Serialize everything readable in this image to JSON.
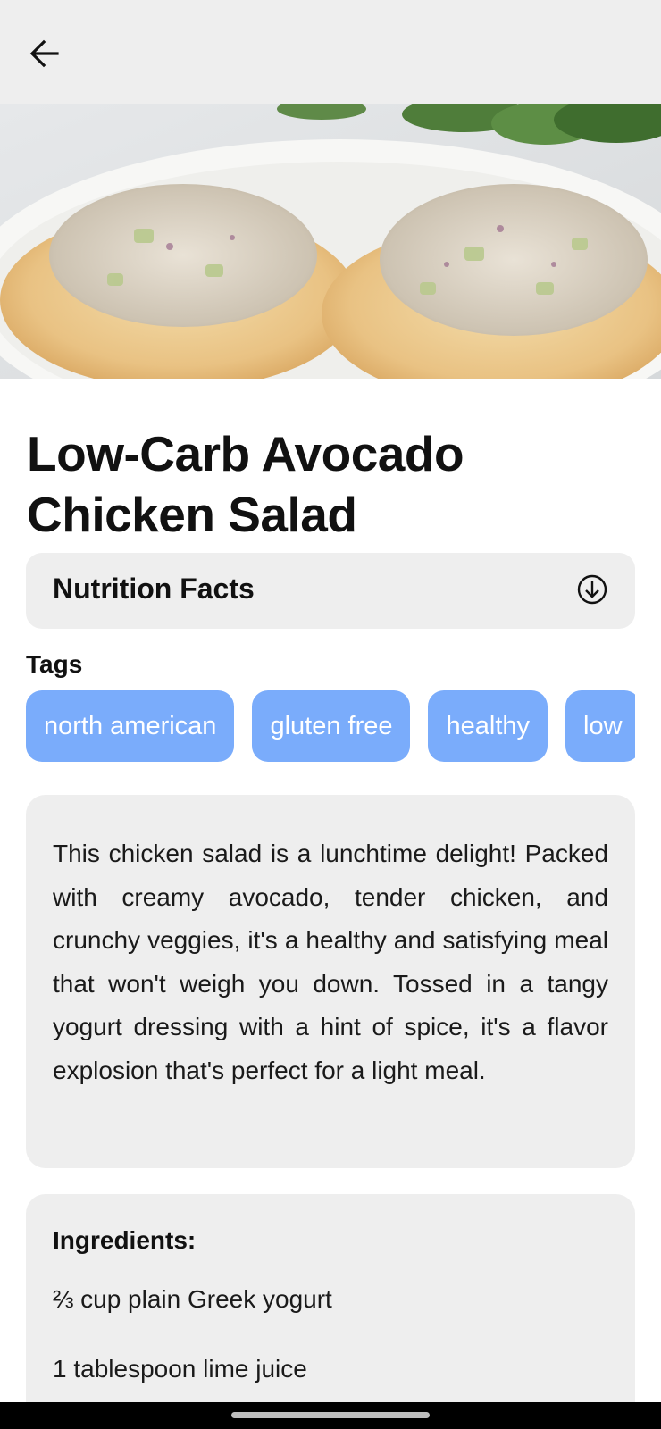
{
  "header": {
    "back_icon": "arrow-left-icon"
  },
  "hero": {
    "image_subject": "chicken salad on flatbread"
  },
  "recipe": {
    "title": "Low-Carb Avocado Chicken Salad"
  },
  "nutrition": {
    "label": "Nutrition Facts",
    "icon": "circle-arrow-down-icon"
  },
  "tags": {
    "heading": "Tags",
    "items": [
      "north american",
      "gluten free",
      "healthy",
      "low"
    ]
  },
  "description": {
    "text": "This chicken salad is a lunchtime delight! Packed with creamy avocado, tender chicken, and crunchy veggies, it's a healthy and satisfying meal that won't weigh you down. Tossed in a tangy yogurt dressing with a hint of spice, it's a flavor explosion that's perfect for a light meal."
  },
  "ingredients": {
    "heading": "Ingredients:",
    "items": [
      "⅔ cup plain Greek yogurt",
      "1 tablespoon lime juice"
    ]
  },
  "colors": {
    "topbar": "#eeeeee",
    "card": "#eeeeee",
    "tag": "#7aacfb",
    "tag_text": "#ffffff",
    "navbar": "#000000"
  }
}
